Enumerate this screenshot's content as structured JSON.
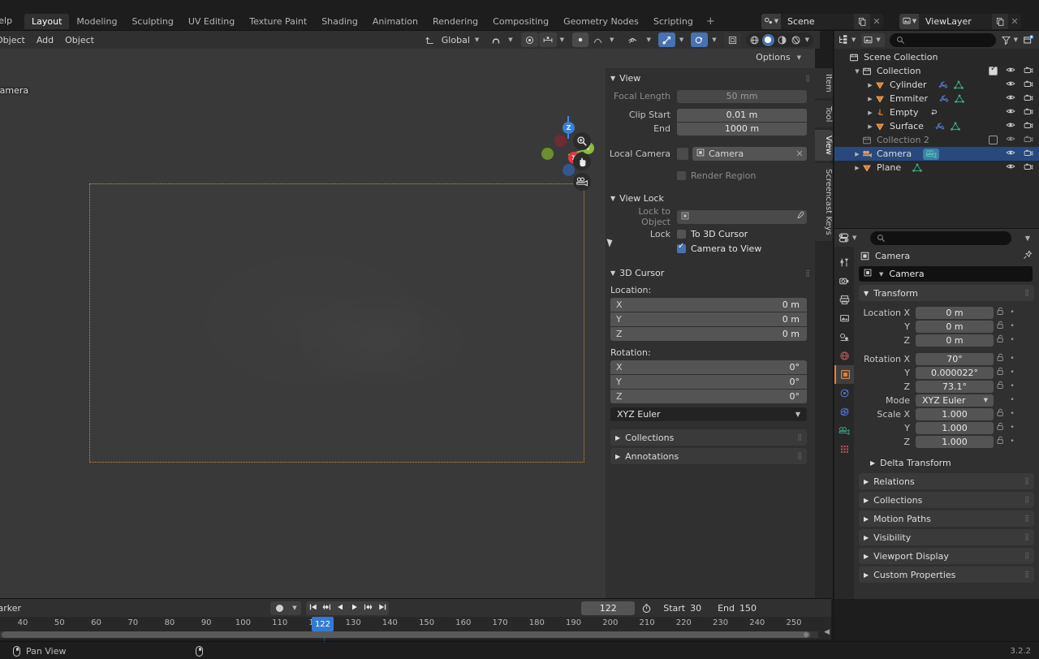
{
  "topbar": {
    "menus": [
      "Help"
    ],
    "workspaces": [
      "Layout",
      "Modeling",
      "Sculpting",
      "UV Editing",
      "Texture Paint",
      "Shading",
      "Animation",
      "Rendering",
      "Compositing",
      "Geometry Nodes",
      "Scripting"
    ],
    "active_workspace": "Layout",
    "add_workspace": "+",
    "scene": {
      "label": "Scene",
      "icon": "scene-icon"
    },
    "view_layer": {
      "label": "ViewLayer",
      "icon": "viewlayer-icon"
    }
  },
  "viewport_header": {
    "menus": [
      "Object",
      "Add",
      "Object"
    ],
    "transform_orientation": "Global",
    "snap_icon": "magnet-icon",
    "proportional_icon": "proportional-edit-icon",
    "visibility_icon": "eye-icon",
    "gizmo_icon": "gizmo-icon",
    "overlays_icon": "overlays-icon",
    "xray_icon": "xray-icon",
    "shading_modes": [
      "wireframe",
      "solid",
      "material-preview",
      "rendered"
    ],
    "active_shading": "solid",
    "options_label": "Options"
  },
  "viewport": {
    "view_label": "Camera",
    "gizmo_axes": [
      "Z",
      "Y",
      "X"
    ],
    "nav_buttons": [
      "zoom-icon",
      "pan-hand-icon",
      "camera-view-icon"
    ]
  },
  "sidebar": {
    "tabs": [
      "Item",
      "Tool",
      "View",
      "Screencast Keys"
    ],
    "active_tab": "View",
    "view": {
      "title": "View",
      "focal_length_label": "Focal Length",
      "focal_length_value": "50 mm",
      "clip_start_label": "Clip Start",
      "clip_start_value": "0.01 m",
      "clip_end_label": "End",
      "clip_end_value": "1000 m",
      "local_camera_label": "Local Camera",
      "local_camera_value": "Camera",
      "render_region_label": "Render Region",
      "render_region_checked": false
    },
    "view_lock": {
      "title": "View Lock",
      "lock_to_object_label": "Lock to Object",
      "lock_to_object_value": "",
      "lock_label": "Lock",
      "to_3d_cursor_label": "To 3D Cursor",
      "to_3d_cursor_checked": false,
      "camera_to_view_label": "Camera to View",
      "camera_to_view_checked": true
    },
    "cursor": {
      "title": "3D Cursor",
      "location_label": "Location:",
      "location": {
        "x_label": "X",
        "x": "0 m",
        "y_label": "Y",
        "y": "0 m",
        "z_label": "Z",
        "z": "0 m"
      },
      "rotation_label": "Rotation:",
      "rotation": {
        "x_label": "X",
        "x": "0°",
        "y_label": "Y",
        "y": "0°",
        "z_label": "Z",
        "z": "0°"
      },
      "mode": "XYZ Euler"
    },
    "collections_title": "Collections",
    "annotations_title": "Annotations"
  },
  "outliner": {
    "display_mode_icon": "outliner-icon",
    "filter_id_icon": "viewlayer-icon",
    "search_placeholder": "",
    "filter_icon": "funnel-icon",
    "new_collection_icon": "new-collection-icon",
    "rows": [
      {
        "name": "Scene Collection",
        "indent": 0,
        "icon": "collection-icon",
        "tri": "",
        "dim": false,
        "checkbox": null,
        "eye": false,
        "camera": false,
        "selected": false,
        "extra": []
      },
      {
        "name": "Collection",
        "indent": 1,
        "icon": "collection-icon",
        "tri": "▼",
        "dim": false,
        "checkbox": true,
        "eye": true,
        "camera": true,
        "selected": false,
        "extra": []
      },
      {
        "name": "Cylinder",
        "indent": 2,
        "icon": "mesh-icon",
        "tri": "▶",
        "dim": false,
        "checkbox": null,
        "eye": true,
        "camera": true,
        "selected": false,
        "extra": [
          "modifier-icon",
          "mesh-data-icon"
        ]
      },
      {
        "name": "Emmiter",
        "indent": 2,
        "icon": "mesh-icon",
        "tri": "▶",
        "dim": false,
        "checkbox": null,
        "eye": true,
        "camera": true,
        "selected": false,
        "extra": [
          "modifier-icon",
          "mesh-data-icon"
        ]
      },
      {
        "name": "Empty",
        "indent": 2,
        "icon": "empty-axes-icon",
        "tri": "▶",
        "dim": false,
        "checkbox": null,
        "eye": true,
        "camera": true,
        "selected": false,
        "extra": [
          "constraint-icon"
        ]
      },
      {
        "name": "Surface",
        "indent": 2,
        "icon": "mesh-icon",
        "tri": "▶",
        "dim": false,
        "checkbox": null,
        "eye": true,
        "camera": true,
        "selected": false,
        "extra": [
          "modifier-icon",
          "mesh-data-icon"
        ]
      },
      {
        "name": "Collection 2",
        "indent": 1,
        "icon": "collection-icon",
        "tri": "",
        "dim": true,
        "checkbox": false,
        "eye": true,
        "camera": true,
        "selected": false,
        "extra": []
      },
      {
        "name": "Camera",
        "indent": 1,
        "icon": "camera-obj-icon",
        "tri": "▶",
        "dim": false,
        "checkbox": null,
        "eye": true,
        "camera": true,
        "selected": true,
        "extra": [
          "camera-data-icon"
        ]
      },
      {
        "name": "Plane",
        "indent": 1,
        "icon": "mesh-icon",
        "tri": "▶",
        "dim": false,
        "checkbox": null,
        "eye": true,
        "camera": true,
        "selected": false,
        "extra": [
          "mesh-data-icon"
        ]
      }
    ]
  },
  "properties": {
    "editor_icon": "properties-editor-icon",
    "search_placeholder": "",
    "tabs": [
      "tool-icon",
      "render-icon",
      "output-icon",
      "view-layer-icon",
      "scene-icon",
      "world-icon",
      "object-icon",
      "modifier-physics-icon",
      "physics-icon",
      "object-data-camera-icon",
      "texture-icon"
    ],
    "active_tab_index": 6,
    "breadcrumb": "Camera",
    "object_name": "Camera",
    "transform": {
      "title": "Transform",
      "location_x_label": "Location X",
      "location_y_label": "Y",
      "location_z_label": "Z",
      "location_x": "0 m",
      "location_y": "0 m",
      "location_z": "0 m",
      "rotation_x_label": "Rotation X",
      "rotation_y_label": "Y",
      "rotation_z_label": "Z",
      "rotation_x": "70°",
      "rotation_y": "0.000022°",
      "rotation_z": "73.1°",
      "mode_label": "Mode",
      "mode_value": "XYZ Euler",
      "scale_x_label": "Scale X",
      "scale_y_label": "Y",
      "scale_z_label": "Z",
      "scale_x": "1.000",
      "scale_y": "1.000",
      "scale_z": "1.000"
    },
    "panels": [
      "Delta Transform",
      "Relations",
      "Collections",
      "Motion Paths",
      "Visibility",
      "Viewport Display",
      "Custom Properties"
    ]
  },
  "timeline": {
    "marker_label": "Marker",
    "playback": [
      "jump-start-icon",
      "prev-keyframe-icon",
      "play-reverse-icon",
      "play-icon",
      "next-keyframe-icon",
      "jump-end-icon"
    ],
    "record_icon": "record-icon",
    "current_frame": "122",
    "start_label": "Start",
    "start_value": "30",
    "end_label": "End",
    "end_value": "150",
    "ticks": [
      40,
      50,
      60,
      70,
      80,
      90,
      100,
      110,
      120,
      130,
      140,
      150,
      160,
      170,
      180,
      190,
      200,
      210,
      220,
      230,
      240,
      250
    ],
    "playhead_frame": 122
  },
  "status": {
    "left_items": [
      {
        "icon": "mouse-middle-icon",
        "label": "Pan View"
      },
      {
        "icon": "mouse-right-icon",
        "label": ""
      }
    ],
    "version": "3.2.2"
  },
  "colors": {
    "accent_blue": "#4772b3",
    "selection_blue": "#27497d",
    "camera_frame": "#c8913f",
    "orange_tab": "#e0833c",
    "playhead": "#337ad4"
  }
}
